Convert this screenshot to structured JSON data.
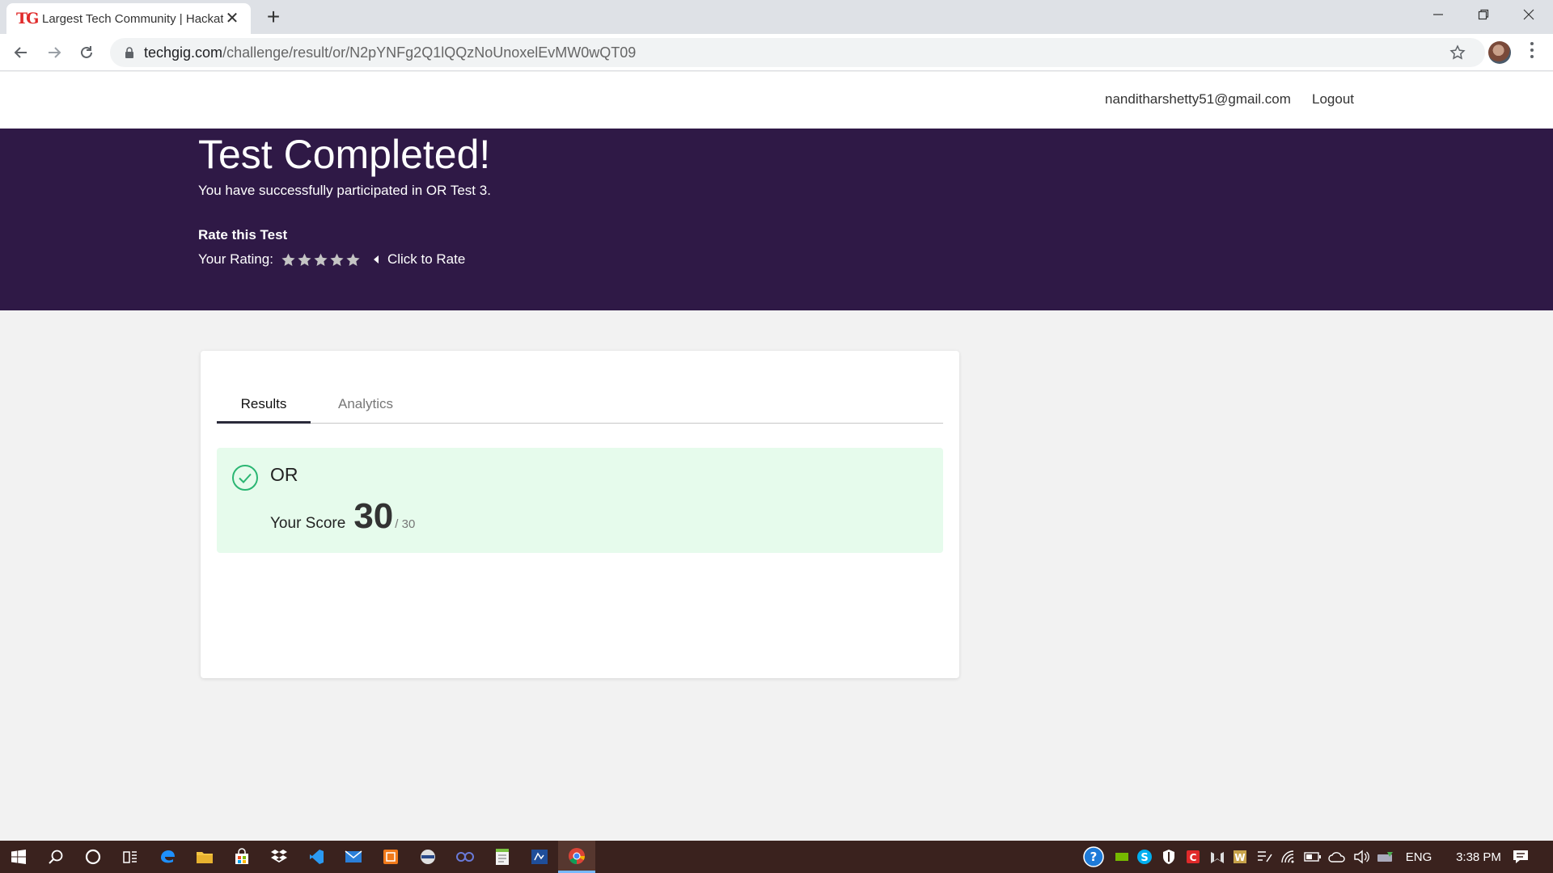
{
  "browser": {
    "tab_title": "Largest Tech Community | Hackat",
    "tab_favicon": "TG",
    "url_host": "techgig.com",
    "url_path": "/challenge/result/or/N2pYNFg2Q1lQQzNoUnoxelEvMW0wQT09"
  },
  "header": {
    "email": "nandithＡrshetty51@gmail.com",
    "logout": "Logout"
  },
  "hero": {
    "title": "Test Completed!",
    "subtitle": "You have successfully participated in OR Test 3.",
    "rate_title": "Rate this Test",
    "rating_label": "Your Rating:",
    "rate_link": "Click to Rate",
    "stars": 5
  },
  "card": {
    "tabs": [
      "Results",
      "Analytics"
    ],
    "subject": "OR",
    "score_label": "Your Score",
    "score": "30",
    "total": "/ 30"
  },
  "taskbar": {
    "lang": "ENG",
    "time": "3:38 PM"
  },
  "colors": {
    "hero_bg": "#2f1946",
    "result_bg": "#e6fbec",
    "check_green": "#2bb673",
    "taskbar_bg": "#3a221e"
  },
  "icons": [
    "windows-start-icon",
    "search-icon",
    "cortana-icon",
    "task-view-icon",
    "edge-icon",
    "file-explorer-icon",
    "store-icon",
    "dropbox-icon",
    "vscode-icon",
    "mail-icon",
    "app-icon",
    "app-icon",
    "app-icon",
    "notepad-icon",
    "app-icon",
    "chrome-icon"
  ]
}
